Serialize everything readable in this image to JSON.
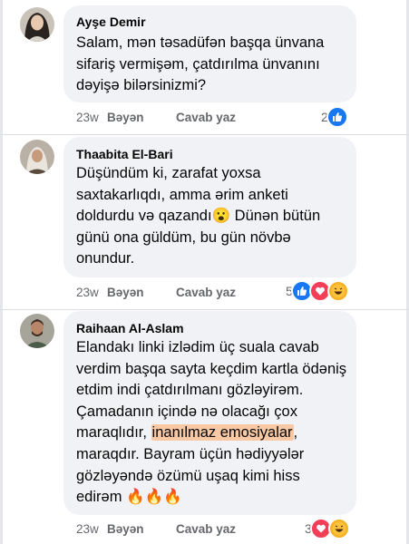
{
  "comments": [
    {
      "author": "Ayşe Demir",
      "text": "Salam, mən təsadüfən başqa ünvana sifariş vermişəm, çatdırılma ünvanını dəyişə bilərsinizmi?",
      "time": "23w",
      "like_label": "Bəyən",
      "reply_label": "Cavab yaz",
      "reaction_count": "2",
      "reactions": [
        "like"
      ]
    },
    {
      "author": "Thaabita El-Bari",
      "text_before": "Düşündüm ki, zarafat yoxsa saxtakarlıqdı, amma ərim anketi doldurdu və qazandı",
      "emoji": "😮",
      "text_after": " Dünən bütün günü ona güldüm, bu gün növbə onundur.",
      "time": "23w",
      "like_label": "Bəyən",
      "reply_label": "Cavab yaz",
      "reaction_count": "5",
      "reactions": [
        "like",
        "love",
        "haha"
      ]
    },
    {
      "author": "Raihaan Al-Aslam",
      "text_before": "Elandakı linki izlədim üç suala cavab verdim başqa sayta keçdim kartla ödəniş etdim indi çatdırılmanı gözləyirəm. Çamadanın içində nə olacağı çox maraqlıdır, ",
      "highlight": "inanılmaz emosiyalar",
      "text_after": ", maraqdır. Bayram üçün hədiyyələr gözləyəndə özümü uşaq kimi hiss edirəm ",
      "fire": "🔥🔥🔥",
      "time": "23w",
      "like_label": "Bəyən",
      "reply_label": "Cavab yaz",
      "reaction_count": "3",
      "reactions": [
        "love",
        "haha"
      ]
    }
  ],
  "colors": {
    "bubble": "#f0f2f5",
    "like_blue": "#1877f2",
    "love_red": "#f33e58",
    "highlight": "#f8c9a4",
    "meta_gray": "#65676b"
  }
}
